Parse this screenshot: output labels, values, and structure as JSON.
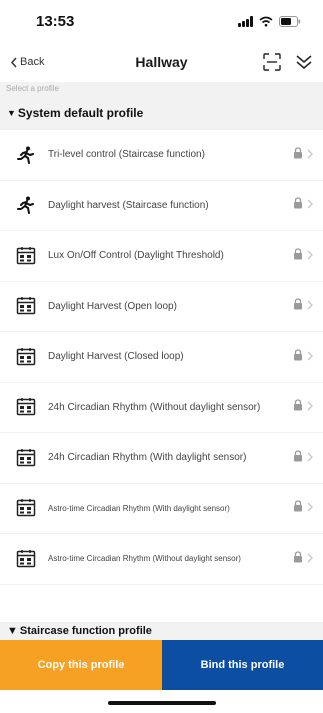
{
  "status": {
    "time": "13:53"
  },
  "nav": {
    "back_label": "Back",
    "title": "Hallway"
  },
  "subheader": "Select a profile",
  "sections": {
    "default": {
      "title": "System default profile"
    },
    "staircase": {
      "title": "Staircase function profile"
    }
  },
  "profiles": [
    {
      "label": "Tri-level control (Staircase function)",
      "icon": "staircase-icon"
    },
    {
      "label": "Daylight harvest (Staircase function)",
      "icon": "staircase-icon"
    },
    {
      "label": "Lux On/Off Control (Daylight Threshold)",
      "icon": "calendar-icon"
    },
    {
      "label": "Daylight Harvest (Open loop)",
      "icon": "calendar-icon"
    },
    {
      "label": "Daylight Harvest (Closed loop)",
      "icon": "calendar-icon"
    },
    {
      "label": "24h Circadian Rhythm (Without daylight sensor)",
      "icon": "calendar-icon"
    },
    {
      "label": "24h Circadian Rhythm (With daylight sensor)",
      "icon": "calendar-icon"
    },
    {
      "label": "Astro-time Circadian Rhythm (With daylight sensor)",
      "icon": "calendar-icon"
    },
    {
      "label": "Astro-time Circadian Rhythm (Without daylight sensor)",
      "icon": "calendar-icon"
    }
  ],
  "buttons": {
    "copy": "Copy this profile",
    "bind": "Bind this profile"
  },
  "colors": {
    "copy_button": "#f6a024",
    "bind_button": "#0b4ea2"
  }
}
